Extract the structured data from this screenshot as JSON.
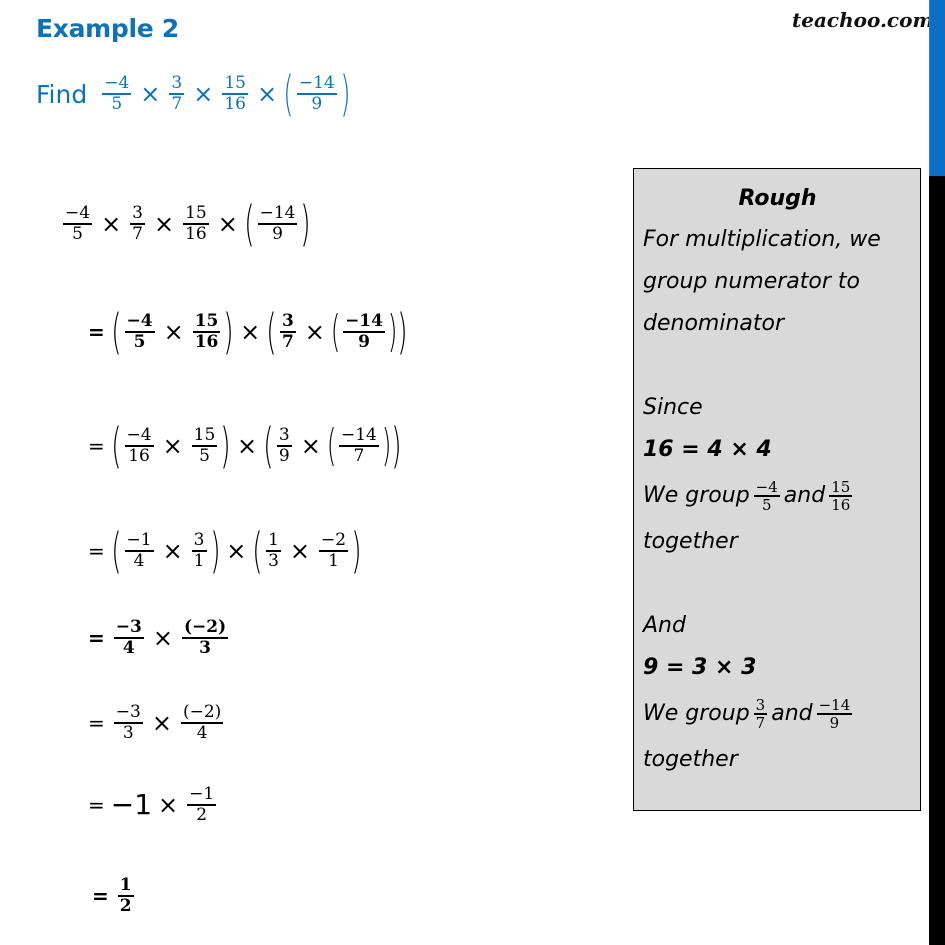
{
  "header": {
    "title": "Example 2",
    "logo": "teachoo.com",
    "brand_color": "#0e72b9"
  },
  "question": {
    "find_label": "Find",
    "fractions": [
      {
        "num": "−4",
        "den": "5"
      },
      {
        "num": "3",
        "den": "7"
      },
      {
        "num": "15",
        "den": "16"
      },
      {
        "num": "−14",
        "den": "9"
      }
    ],
    "times": "×",
    "open_paren": "(",
    "close_paren": ")"
  },
  "solution": {
    "eq": "=",
    "times": "×",
    "lparen": "(",
    "rparen": ")",
    "step0": [
      {
        "num": "−4",
        "den": "5"
      },
      {
        "num": "3",
        "den": "7"
      },
      {
        "num": "15",
        "den": "16"
      },
      {
        "num": "−14",
        "den": "9"
      }
    ],
    "step1": [
      {
        "num": "−4",
        "den": "5"
      },
      {
        "num": "15",
        "den": "16"
      },
      {
        "num": "3",
        "den": "7"
      },
      {
        "num": "−14",
        "den": "9"
      }
    ],
    "step2": [
      {
        "num": "−4",
        "den": "16"
      },
      {
        "num": "15",
        "den": "5"
      },
      {
        "num": "3",
        "den": "9"
      },
      {
        "num": "−14",
        "den": "7"
      }
    ],
    "step3": [
      {
        "num": "−1",
        "den": "4"
      },
      {
        "num": "3",
        "den": "1"
      },
      {
        "num": "1",
        "den": "3"
      },
      {
        "num": "−2",
        "den": "1"
      }
    ],
    "step4": [
      {
        "num": "−3",
        "den": "4"
      },
      {
        "num": "(−2)",
        "den": "3"
      }
    ],
    "step5": [
      {
        "num": "−3",
        "den": "3"
      },
      {
        "num": "(−2)",
        "den": "4"
      }
    ],
    "step6": {
      "whole": "−1",
      "frac": {
        "num": "−1",
        "den": "2"
      }
    },
    "answer": {
      "num": "1",
      "den": "2"
    }
  },
  "rough": {
    "title": "Rough",
    "lines": [
      "For multiplication, we",
      "group numerator to",
      "denominator"
    ],
    "since": "Since",
    "fact1": "16 = 4 × 4",
    "group_word": "We group",
    "and_word": "and",
    "together": "together",
    "group1": [
      {
        "num": "−4",
        "den": "5"
      },
      {
        "num": "15",
        "den": "16"
      }
    ],
    "and_label": "And",
    "fact2": "9 = 3 × 3",
    "group2": [
      {
        "num": "3",
        "den": "7"
      },
      {
        "num": "−14",
        "den": "9"
      }
    ]
  }
}
